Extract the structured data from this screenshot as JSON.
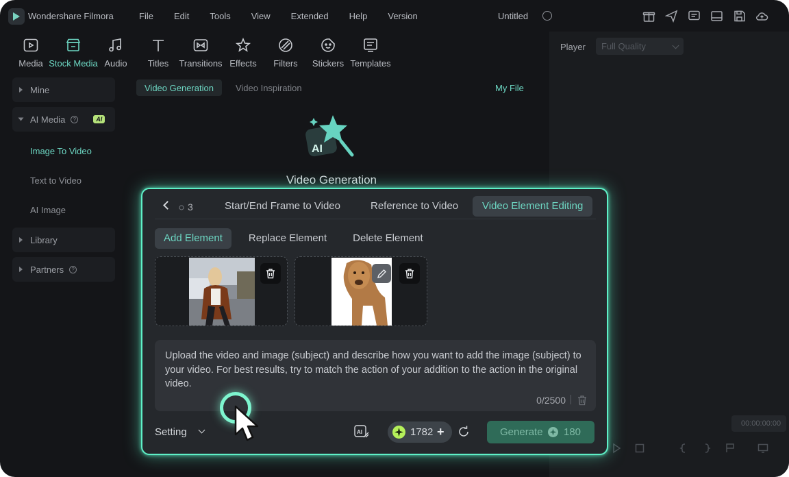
{
  "app": {
    "name": "Wondershare Filmora",
    "document_title": "Untitled"
  },
  "menu": [
    "File",
    "Edit",
    "Tools",
    "View",
    "Extended",
    "Help",
    "Version"
  ],
  "toolbar": [
    {
      "label": "Media",
      "icon": "media-icon"
    },
    {
      "label": "Stock Media",
      "icon": "stock-media-icon",
      "active": true
    },
    {
      "label": "Audio",
      "icon": "audio-icon"
    },
    {
      "label": "Titles",
      "icon": "titles-icon"
    },
    {
      "label": "Transitions",
      "icon": "transitions-icon"
    },
    {
      "label": "Effects",
      "icon": "effects-icon"
    },
    {
      "label": "Filters",
      "icon": "filters-icon"
    },
    {
      "label": "Stickers",
      "icon": "stickers-icon"
    },
    {
      "label": "Templates",
      "icon": "templates-icon"
    }
  ],
  "sidebar": {
    "mine": "Mine",
    "ai_media": "AI Media",
    "ai_badge": "AI",
    "sub_items": [
      "Image To Video",
      "Text to Video",
      "AI Image"
    ],
    "library": "Library",
    "partners": "Partners"
  },
  "center": {
    "tabs": [
      "Video Generation",
      "Video Inspiration"
    ],
    "my_file": "My File",
    "hero_title": "Video Generation"
  },
  "player": {
    "label": "Player",
    "quality": "Full Quality",
    "timecode": "00:00:00:00"
  },
  "dialog": {
    "tab_counter": "3",
    "tabs": [
      "Start/End Frame to Video",
      "Reference to Video",
      "Video Element Editing"
    ],
    "subtabs": [
      "Add Element",
      "Replace Element",
      "Delete Element"
    ],
    "prompt": "Upload the video and image (subject) and describe how you want to add the image (subject) to your video. For best results, try to match the action of your addition to the action in the original video.",
    "char_count": "0/2500",
    "setting_label": "Setting",
    "credits": "1782",
    "generate_label": "Generate",
    "generate_cost": "180"
  },
  "colors": {
    "accent": "#6dd7c3",
    "glow": "#5ef0c7",
    "background": "#141518",
    "credit_coin": "#b5f05a"
  }
}
